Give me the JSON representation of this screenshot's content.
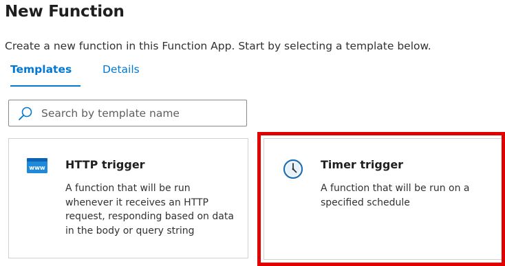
{
  "header": {
    "title": "New Function",
    "subtitle": "Create a new function in this Function App. Start by selecting a template below."
  },
  "tabs": [
    {
      "label": "Templates",
      "active": true
    },
    {
      "label": "Details",
      "active": false
    }
  ],
  "search": {
    "placeholder": "Search by template name",
    "value": ""
  },
  "templates": [
    {
      "title": "HTTP trigger",
      "description": "A function that will be run whenever it receives an HTTP request, responding based on data in the body or query string",
      "icon": "www-icon",
      "icon_text": "www"
    },
    {
      "title": "Timer trigger",
      "description": "A function that will be run on a specified schedule",
      "icon": "clock-icon",
      "highlighted": true
    }
  ],
  "colors": {
    "accent": "#0078d4",
    "highlight": "#e00000"
  }
}
